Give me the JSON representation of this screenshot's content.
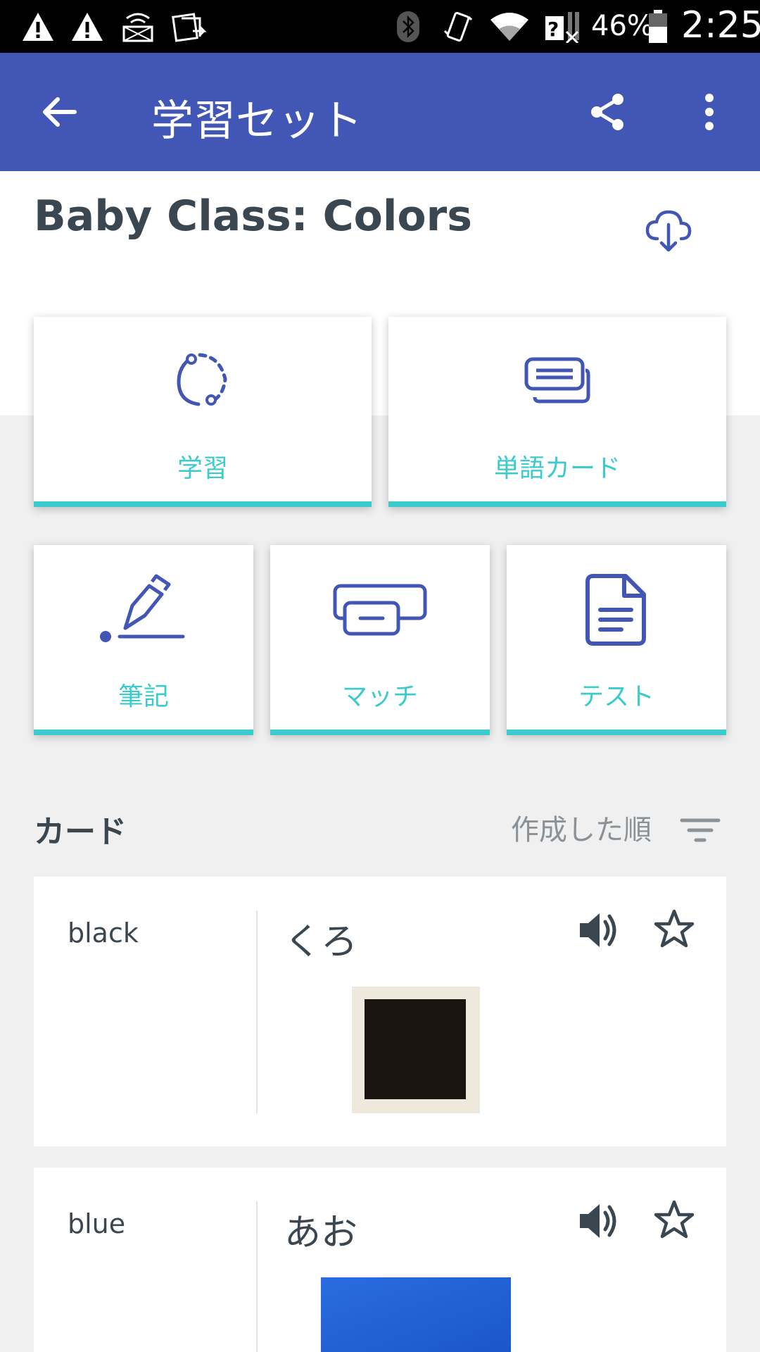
{
  "status_bar": {
    "battery": "46%",
    "time": "2:25"
  },
  "app_bar": {
    "title": "学習セット"
  },
  "set": {
    "title": "Baby Class: Colors"
  },
  "modes": [
    {
      "label": "学習",
      "icon": "learn-icon"
    },
    {
      "label": "単語カード",
      "icon": "flashcards-icon"
    },
    {
      "label": "筆記",
      "icon": "write-icon"
    },
    {
      "label": "マッチ",
      "icon": "match-icon"
    },
    {
      "label": "テスト",
      "icon": "test-icon"
    }
  ],
  "cards_section": {
    "title": "カード",
    "sort_label": "作成した順"
  },
  "terms": [
    {
      "word": "black",
      "definition": "くろ",
      "image_color": "#1a1410"
    },
    {
      "word": "blue",
      "definition": "あお",
      "image_color": "#1f5fd6"
    }
  ],
  "colors": {
    "primary": "#4257b5",
    "accent": "#3ccbcc",
    "text_dark": "#3a4650"
  }
}
